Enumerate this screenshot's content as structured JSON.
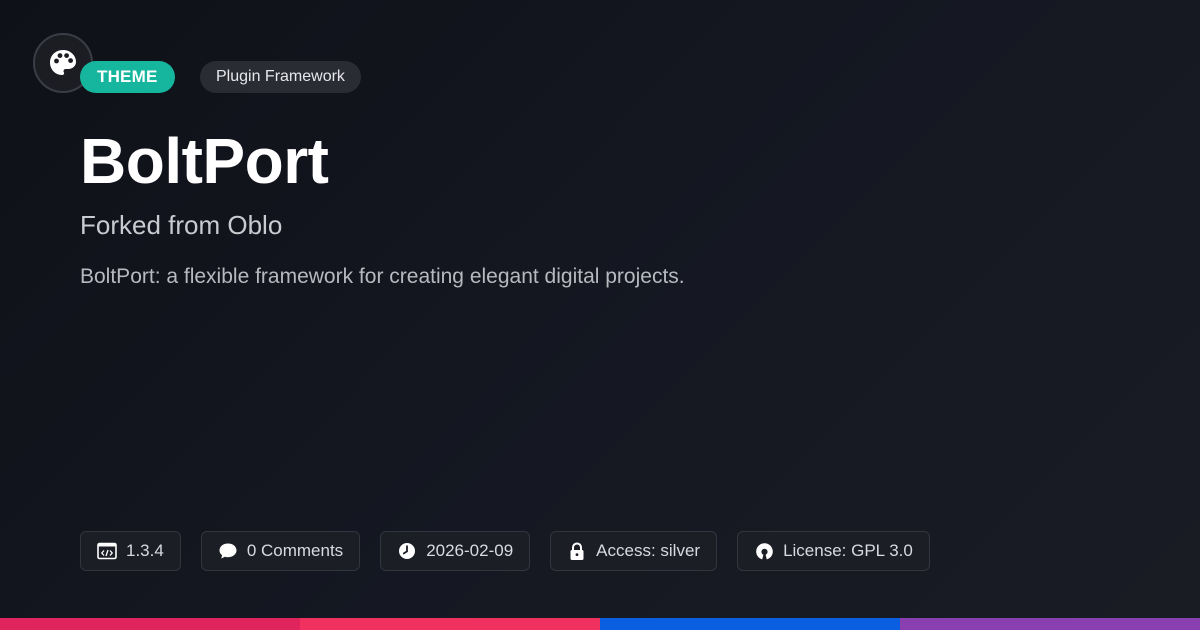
{
  "header": {
    "logo_icon": "palette-icon",
    "type_badge": "THEME",
    "category": "Plugin Framework"
  },
  "main": {
    "title": "BoltPort",
    "subtitle": "Forked from Oblo",
    "description": "BoltPort: a flexible framework for creating elegant digital projects."
  },
  "meta": {
    "version": {
      "icon": "code-icon",
      "label": "1.3.4"
    },
    "comments": {
      "icon": "comment-icon",
      "label": "0 Comments"
    },
    "date": {
      "icon": "clock-icon",
      "label": "2026-02-09"
    },
    "access": {
      "icon": "lock-icon",
      "label": "Access: silver"
    },
    "license": {
      "icon": "open-source-icon",
      "label": "License: GPL 3.0"
    }
  },
  "colors": {
    "badge": "#16b69e",
    "stripe": [
      "#e0245e",
      "#f0305e",
      "#0a5fe0",
      "#8a3fb0"
    ]
  }
}
